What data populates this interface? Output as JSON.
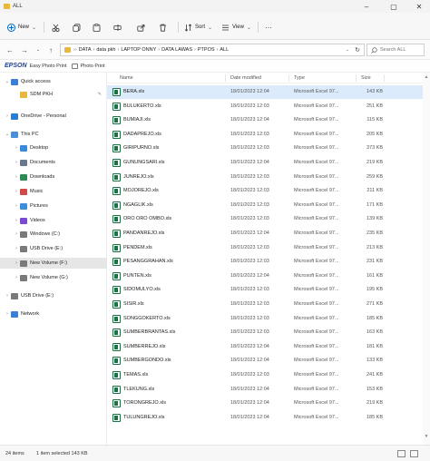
{
  "window": {
    "title": "ALL"
  },
  "ribbon": {
    "new_label": "New",
    "sort_label": "Sort",
    "view_label": "View",
    "more_label": "···"
  },
  "address": {
    "crumbs": [
      "DATA",
      "data pkh",
      "LAPTOP ONNY",
      "DATA LAWAS",
      "PTPOS",
      "ALL"
    ],
    "search_placeholder": "Search ALL"
  },
  "epson": {
    "brand": "EPSON",
    "easy_photo_print": "Easy Photo Print",
    "photo_print": "Photo Print"
  },
  "nav": {
    "items": [
      {
        "label": "Quick access",
        "level": 0,
        "chevron": "⌄",
        "icon": "star-icon",
        "color": "#3b7ed6"
      },
      {
        "label": "SDM PKH",
        "level": 1,
        "chevron": "",
        "icon": "folder-icon",
        "color": "#e8b73d",
        "pinned": true
      },
      {
        "label": "OneDrive - Personal",
        "level": 0,
        "chevron": "›",
        "icon": "cloud-icon",
        "color": "#2b7cd3"
      },
      {
        "label": "This PC",
        "level": 0,
        "chevron": "⌄",
        "icon": "computer-icon",
        "color": "#4a90d9"
      },
      {
        "label": "Desktop",
        "level": 1,
        "chevron": "›",
        "icon": "desktop-icon",
        "color": "#3b8bdc"
      },
      {
        "label": "Documents",
        "level": 1,
        "chevron": "›",
        "icon": "documents-icon",
        "color": "#6a7a8c"
      },
      {
        "label": "Downloads",
        "level": 1,
        "chevron": "›",
        "icon": "downloads-icon",
        "color": "#2e8b57"
      },
      {
        "label": "Music",
        "level": 1,
        "chevron": "›",
        "icon": "music-icon",
        "color": "#d04a4a"
      },
      {
        "label": "Pictures",
        "level": 1,
        "chevron": "›",
        "icon": "pictures-icon",
        "color": "#3c8fd8"
      },
      {
        "label": "Videos",
        "level": 1,
        "chevron": "›",
        "icon": "videos-icon",
        "color": "#7a4ad0"
      },
      {
        "label": "Windows (C:)",
        "level": 1,
        "chevron": "›",
        "icon": "drive-icon",
        "color": "#7a7a7a"
      },
      {
        "label": "USB Drive (E:)",
        "level": 1,
        "chevron": "›",
        "icon": "usb-drive-icon",
        "color": "#7a7a7a"
      },
      {
        "label": "New Volume (F:)",
        "level": 1,
        "chevron": "›",
        "icon": "drive-icon",
        "color": "#7a7a7a",
        "selected": true
      },
      {
        "label": "New Volume (G:)",
        "level": 1,
        "chevron": "›",
        "icon": "drive-icon",
        "color": "#7a7a7a"
      },
      {
        "label": "USB Drive (E:)",
        "level": 0,
        "chevron": "›",
        "icon": "usb-drive-icon",
        "color": "#7a7a7a"
      },
      {
        "label": "Network",
        "level": 0,
        "chevron": "›",
        "icon": "network-icon",
        "color": "#3b7ed6"
      }
    ]
  },
  "columns": {
    "name": "Name",
    "date": "Date modified",
    "type": "Type",
    "size": "Size"
  },
  "files": [
    {
      "name": "BERA.xls",
      "date": "18/01/2023 12:04",
      "type": "Microsoft Excel 97...",
      "size": "143 KB",
      "selected": true
    },
    {
      "name": "BULUKERTO.xls",
      "date": "18/01/2023 12:03",
      "type": "Microsoft Excel 97...",
      "size": "251 KB"
    },
    {
      "name": "BUMIAJI.xls",
      "date": "18/01/2023 12:04",
      "type": "Microsoft Excel 97...",
      "size": "115 KB"
    },
    {
      "name": "DADAPREJO.xls",
      "date": "18/01/2023 12:03",
      "type": "Microsoft Excel 97...",
      "size": "205 KB"
    },
    {
      "name": "GIRIPURNO.xls",
      "date": "18/01/2023 12:03",
      "type": "Microsoft Excel 97...",
      "size": "373 KB"
    },
    {
      "name": "GUNUNGSARI.xls",
      "date": "18/01/2023 12:04",
      "type": "Microsoft Excel 97...",
      "size": "219 KB"
    },
    {
      "name": "JUNREJO.xls",
      "date": "18/01/2023 12:03",
      "type": "Microsoft Excel 97...",
      "size": "259 KB"
    },
    {
      "name": "MOJOREJO.xls",
      "date": "18/01/2023 12:03",
      "type": "Microsoft Excel 97...",
      "size": "211 KB"
    },
    {
      "name": "NGAGLIK.xls",
      "date": "18/01/2023 12:03",
      "type": "Microsoft Excel 97...",
      "size": "171 KB"
    },
    {
      "name": "ORO ORO OMBO.xls",
      "date": "18/01/2023 12:03",
      "type": "Microsoft Excel 97...",
      "size": "139 KB"
    },
    {
      "name": "PANDANREJO.xls",
      "date": "18/01/2023 12:04",
      "type": "Microsoft Excel 97...",
      "size": "235 KB"
    },
    {
      "name": "PENDEM.xls",
      "date": "18/01/2023 12:03",
      "type": "Microsoft Excel 97...",
      "size": "213 KB"
    },
    {
      "name": "PESANGGRAHAN.xls",
      "date": "18/01/2023 12:03",
      "type": "Microsoft Excel 97...",
      "size": "231 KB"
    },
    {
      "name": "PUNTEN.xls",
      "date": "18/01/2023 12:04",
      "type": "Microsoft Excel 97...",
      "size": "161 KB"
    },
    {
      "name": "SIDOMULYO.xls",
      "date": "18/01/2023 12:03",
      "type": "Microsoft Excel 97...",
      "size": "195 KB"
    },
    {
      "name": "SISIR.xls",
      "date": "18/01/2023 12:03",
      "type": "Microsoft Excel 97...",
      "size": "271 KB"
    },
    {
      "name": "SONGGOKERTO.xls",
      "date": "18/01/2023 12:03",
      "type": "Microsoft Excel 97...",
      "size": "185 KB"
    },
    {
      "name": "SUMBERBRANTAS.xls",
      "date": "18/01/2023 12:03",
      "type": "Microsoft Excel 97...",
      "size": "163 KB"
    },
    {
      "name": "SUMBERREJO.xls",
      "date": "18/01/2023 12:04",
      "type": "Microsoft Excel 97...",
      "size": "181 KB"
    },
    {
      "name": "SUMBERGONDO.xls",
      "date": "18/01/2023 12:04",
      "type": "Microsoft Excel 97...",
      "size": "133 KB"
    },
    {
      "name": "TEMAS.xls",
      "date": "18/01/2023 12:03",
      "type": "Microsoft Excel 97...",
      "size": "241 KB"
    },
    {
      "name": "TLEKUNG.xls",
      "date": "18/01/2023 12:04",
      "type": "Microsoft Excel 97...",
      "size": "153 KB"
    },
    {
      "name": "TORONGREJO.xls",
      "date": "18/01/2023 12:04",
      "type": "Microsoft Excel 97...",
      "size": "219 KB"
    },
    {
      "name": "TULUNGREJO.xls",
      "date": "18/01/2023 12:04",
      "type": "Microsoft Excel 97...",
      "size": "185 KB"
    }
  ],
  "status": {
    "count": "24 items",
    "selection": "1 item selected  143 KB"
  },
  "colors": {
    "accent": "#0067c0",
    "selected_row": "#dcebfb",
    "excel_green": "#1e7145",
    "folder_yellow": "#e8b73d"
  }
}
